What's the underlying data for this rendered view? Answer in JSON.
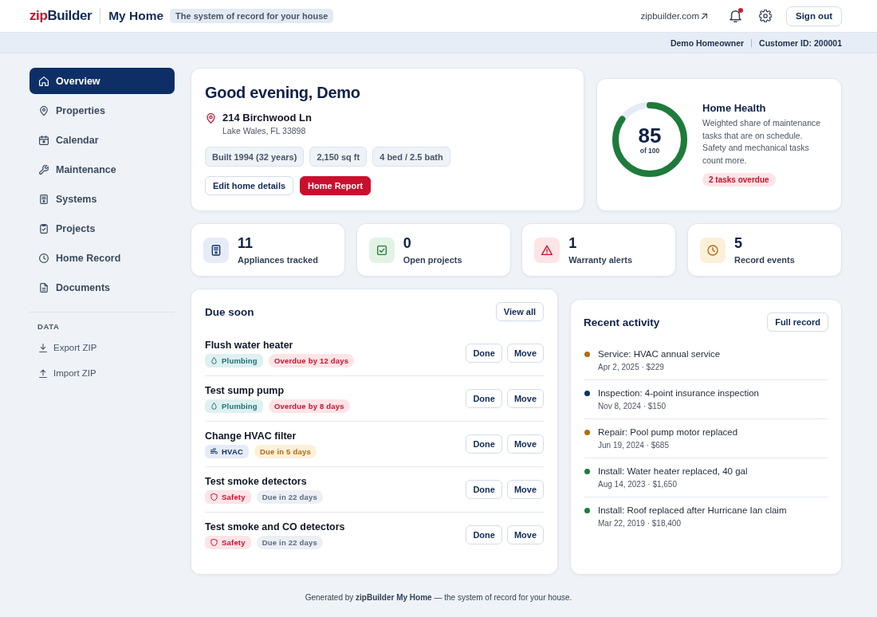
{
  "header": {
    "logo": {
      "accent": "zip",
      "rest": "Builder"
    },
    "app_title": "My Home",
    "tagline": "The system of record for your house",
    "site_link": "zipbuilder.com",
    "bell_unread": true,
    "sign_out": "Sign out"
  },
  "account_bar": {
    "name": "Demo Homeowner",
    "customer_id": "Customer ID: 200001"
  },
  "sidebar": {
    "items": [
      {
        "label": "Overview",
        "selected": true
      },
      {
        "label": "Properties",
        "selected": false
      },
      {
        "label": "Calendar",
        "selected": false
      },
      {
        "label": "Maintenance",
        "selected": false
      },
      {
        "label": "Systems",
        "selected": false
      },
      {
        "label": "Projects",
        "selected": false
      },
      {
        "label": "Home Record",
        "selected": false
      },
      {
        "label": "Documents",
        "selected": false
      }
    ],
    "section_label": "DATA",
    "data_items": [
      {
        "label": "Export ZIP"
      },
      {
        "label": "Import ZIP"
      }
    ]
  },
  "greeting": {
    "title": "Good evening, Demo",
    "address": "214 Birchwood Ln",
    "city": "Lake Wales, FL 33898",
    "facts": [
      "Built 1994 (32 years)",
      "2,150 sq ft",
      "4 bed / 2.5 bath"
    ],
    "buttons": [
      {
        "label": "Edit home details",
        "kind": "secondary"
      },
      {
        "label": "Home Report",
        "kind": "primary"
      }
    ]
  },
  "health": {
    "score": "85",
    "scale": "of 100",
    "level": 0.85,
    "title": "Home Health",
    "description": "Weighted share of maintenance tasks that are on schedule. Safety and mechanical tasks count more.",
    "badge": "2 tasks overdue"
  },
  "stats": [
    {
      "value": "11",
      "label": "Appliances tracked"
    },
    {
      "value": "0",
      "label": "Open projects"
    },
    {
      "value": "1",
      "label": "Warranty alerts"
    },
    {
      "value": "5",
      "label": "Record events"
    }
  ],
  "due_soon": {
    "title": "Due soon",
    "action": "View all",
    "tasks": [
      {
        "title": "Flush water heater",
        "category": {
          "label": "Plumbing",
          "kind": "plumbing"
        },
        "status": {
          "label": "Overdue by 12 days",
          "kind": "overdue"
        },
        "actions": [
          "Done",
          "Move"
        ]
      },
      {
        "title": "Test sump pump",
        "category": {
          "label": "Plumbing",
          "kind": "plumbing"
        },
        "status": {
          "label": "Overdue by 8 days",
          "kind": "overdue"
        },
        "actions": [
          "Done",
          "Move"
        ]
      },
      {
        "title": "Change HVAC filter",
        "category": {
          "label": "HVAC",
          "kind": "hvac"
        },
        "status": {
          "label": "Due in 5 days",
          "kind": "soon"
        },
        "actions": [
          "Done",
          "Move"
        ]
      },
      {
        "title": "Test smoke detectors",
        "category": {
          "label": "Safety",
          "kind": "safety"
        },
        "status": {
          "label": "Due in 22 days",
          "kind": "later"
        },
        "actions": [
          "Done",
          "Move"
        ]
      },
      {
        "title": "Test smoke and CO detectors",
        "category": {
          "label": "Safety",
          "kind": "safety"
        },
        "status": {
          "label": "Due in 22 days",
          "kind": "later"
        },
        "actions": [
          "Done",
          "Move"
        ]
      }
    ]
  },
  "recent_activity": {
    "title": "Recent activity",
    "action": "Full record",
    "items": [
      {
        "title": "Service: HVAC annual service",
        "detail": "Apr 2, 2025 · $229",
        "color": "#b4690e"
      },
      {
        "title": "Inspection: 4-point insurance inspection",
        "detail": "Nov 8, 2024 · $150",
        "color": "#0f2f66"
      },
      {
        "title": "Repair: Pool pump motor replaced",
        "detail": "Jun 19, 2024 · $685",
        "color": "#b4690e"
      },
      {
        "title": "Install: Water heater replaced, 40 gal",
        "detail": "Aug 14, 2023 · $1,650",
        "color": "#1e7b3a"
      },
      {
        "title": "Install: Roof replaced after Hurricane Ian claim",
        "detail": "Mar 22, 2019 · $18,400",
        "color": "#1e7b3a"
      }
    ]
  },
  "footer": "Generated by **zipBuilder My Home** — the system of record for your house."
}
